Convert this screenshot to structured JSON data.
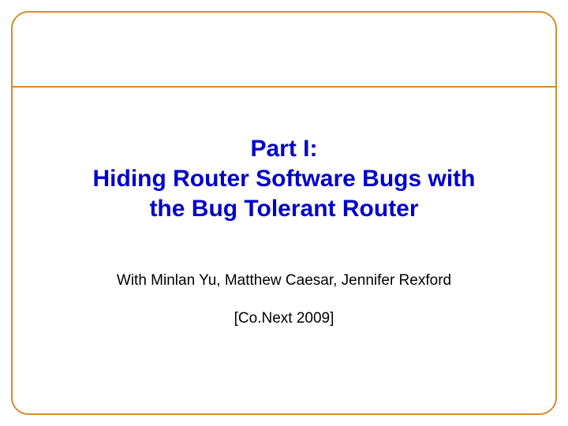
{
  "title": {
    "line1": "Part I:",
    "line2": "Hiding Router Software Bugs with",
    "line3": "the Bug Tolerant Router"
  },
  "authors": "With Minlan Yu, Matthew Caesar, Jennifer Rexford",
  "venue": "[Co.Next 2009]"
}
